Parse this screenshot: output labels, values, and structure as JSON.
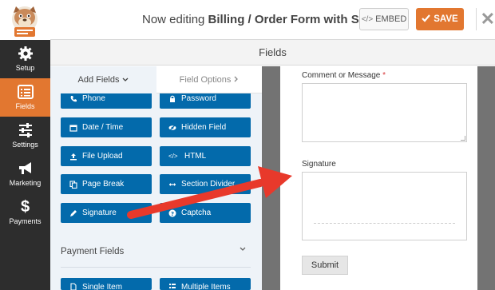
{
  "header": {
    "editing_prefix": "Now editing ",
    "form_name": "Billing / Order Form with Signature",
    "embed_label": "EMBED",
    "save_label": "SAVE"
  },
  "sidebar": {
    "items": [
      {
        "label": "Setup",
        "icon": "gear-icon"
      },
      {
        "label": "Fields",
        "icon": "list-icon",
        "active": true
      },
      {
        "label": "Settings",
        "icon": "sliders-icon"
      },
      {
        "label": "Marketing",
        "icon": "megaphone-icon"
      },
      {
        "label": "Payments",
        "icon": "dollar-icon"
      }
    ]
  },
  "main": {
    "title": "Fields",
    "tabs": [
      {
        "label": "Add Fields",
        "icon": "chevron-down-icon",
        "active": true
      },
      {
        "label": "Field Options",
        "icon": "chevron-right-icon"
      }
    ],
    "field_buttons": [
      {
        "label": "Phone",
        "icon": "phone-icon"
      },
      {
        "label": "Password",
        "icon": "lock-icon"
      },
      {
        "label": "Date / Time",
        "icon": "calendar-icon"
      },
      {
        "label": "Hidden Field",
        "icon": "eye-slash-icon"
      },
      {
        "label": "File Upload",
        "icon": "upload-icon"
      },
      {
        "label": "HTML",
        "icon": "code-icon"
      },
      {
        "label": "Page Break",
        "icon": "copy-icon"
      },
      {
        "label": "Section Divider",
        "icon": "arrows-h-icon"
      },
      {
        "label": "Signature",
        "icon": "pencil-icon"
      },
      {
        "label": "Captcha",
        "icon": "question-circle-icon"
      }
    ],
    "payment_section": {
      "title": "Payment Fields",
      "buttons": [
        {
          "label": "Single Item",
          "icon": "file-icon"
        },
        {
          "label": "Multiple Items",
          "icon": "list-icon"
        }
      ]
    }
  },
  "preview": {
    "comment_label": "Comment or Message",
    "required_mark": "*",
    "signature_label": "Signature",
    "submit_label": "Submit"
  },
  "colors": {
    "accent": "#e27730",
    "field_button": "#036aab",
    "sidebar": "#2d2d2d",
    "arrow": "#e8392b"
  }
}
